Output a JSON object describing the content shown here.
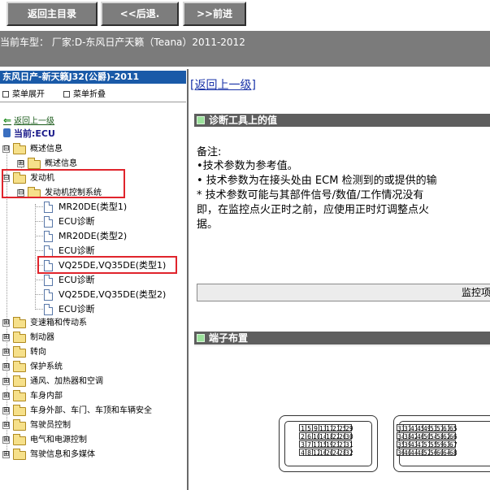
{
  "toolbar": {
    "home_label": "返回主目录",
    "back_label": "<<后退.",
    "forward_label": ">>前进"
  },
  "vehicle": {
    "info": "当前车型：   厂家:D-东风日产天籁（Teana）2011-2012"
  },
  "tree": {
    "title": "东风日产-新天籁J32(公爵)-2011",
    "expand_label": "菜单展开",
    "collapse_label": "菜单折叠",
    "back_link": "返回上一级",
    "current": "当前:ECU",
    "nodes": [
      {
        "label": "概述信息",
        "sign": "⊟"
      },
      {
        "label": "概述信息",
        "sign": "⊞"
      },
      {
        "label": "发动机",
        "sign": "⊟"
      },
      {
        "label": "发动机控制系统",
        "sign": "⊟"
      },
      {
        "label": "MR20DE(类型1)"
      },
      {
        "label": "ECU诊断"
      },
      {
        "label": "MR20DE(类型2)"
      },
      {
        "label": "ECU诊断"
      },
      {
        "label": "VQ25DE,VQ35DE(类型1)"
      },
      {
        "label": "ECU诊断"
      },
      {
        "label": "VQ25DE,VQ35DE(类型2)"
      },
      {
        "label": "ECU诊断"
      },
      {
        "label": "变速箱和传动系",
        "sign": "⊞"
      },
      {
        "label": "制动器",
        "sign": "⊞"
      },
      {
        "label": "转向",
        "sign": "⊞"
      },
      {
        "label": "保护系统",
        "sign": "⊞"
      },
      {
        "label": "通风、加热器和空调",
        "sign": "⊞"
      },
      {
        "label": "车身内部",
        "sign": "⊞"
      },
      {
        "label": "车身外部、车门、车顶和车辆安全",
        "sign": "⊞"
      },
      {
        "label": "驾驶员控制",
        "sign": "⊞"
      },
      {
        "label": "电气和电源控制",
        "sign": "⊞"
      },
      {
        "label": "驾驶信息和多媒体",
        "sign": "⊞"
      }
    ]
  },
  "content": {
    "up_link": "[返回上一级]",
    "section1_title": "诊断工具上的值",
    "note_lines": [
      "备注:",
      "•技术参数为参考值。",
      "• 技术参数为在接头处由 ECM 检测到的或提供的输",
      "   * 技术参数可能与其部件信号/数值/工作情况没有",
      "   即，在监控点火正时之前，应使用正时灯调整点火",
      "据。"
    ],
    "monitor_label": "监控项",
    "section2_title": "端子布置",
    "connector1_rows": [
      [
        "1",
        "5",
        "9",
        "13",
        "17",
        "21",
        "25",
        "29"
      ],
      [
        "2",
        "6",
        "10",
        "14",
        "18",
        "22",
        "26",
        "30"
      ],
      [
        "3",
        "7",
        "11",
        "15",
        "19",
        "23",
        "27",
        "31"
      ],
      [
        "4",
        "8",
        "12",
        "16",
        "20",
        "24",
        "28",
        "32"
      ]
    ],
    "connector2_rows": [
      [
        "33",
        "37",
        "41",
        "45",
        "49",
        "53",
        "57",
        "61",
        "65"
      ],
      [
        "34",
        "38",
        "42",
        "46",
        "50",
        "54",
        "58",
        "62",
        "66"
      ],
      [
        "35",
        "39",
        "43",
        "47",
        "51",
        "55",
        "59",
        "63",
        "67"
      ],
      [
        "36",
        "40",
        "44",
        "48",
        "52",
        "56",
        "60",
        "64",
        "68"
      ]
    ]
  },
  "colors": {
    "toolbar_button": "#7d7d7d",
    "vehicle_bar": "#7b7b7b",
    "tree_title": "#1a5aa8",
    "section_header": "#5e5e5e",
    "highlight_box": "#e0242c",
    "link": "#1a33a8"
  }
}
